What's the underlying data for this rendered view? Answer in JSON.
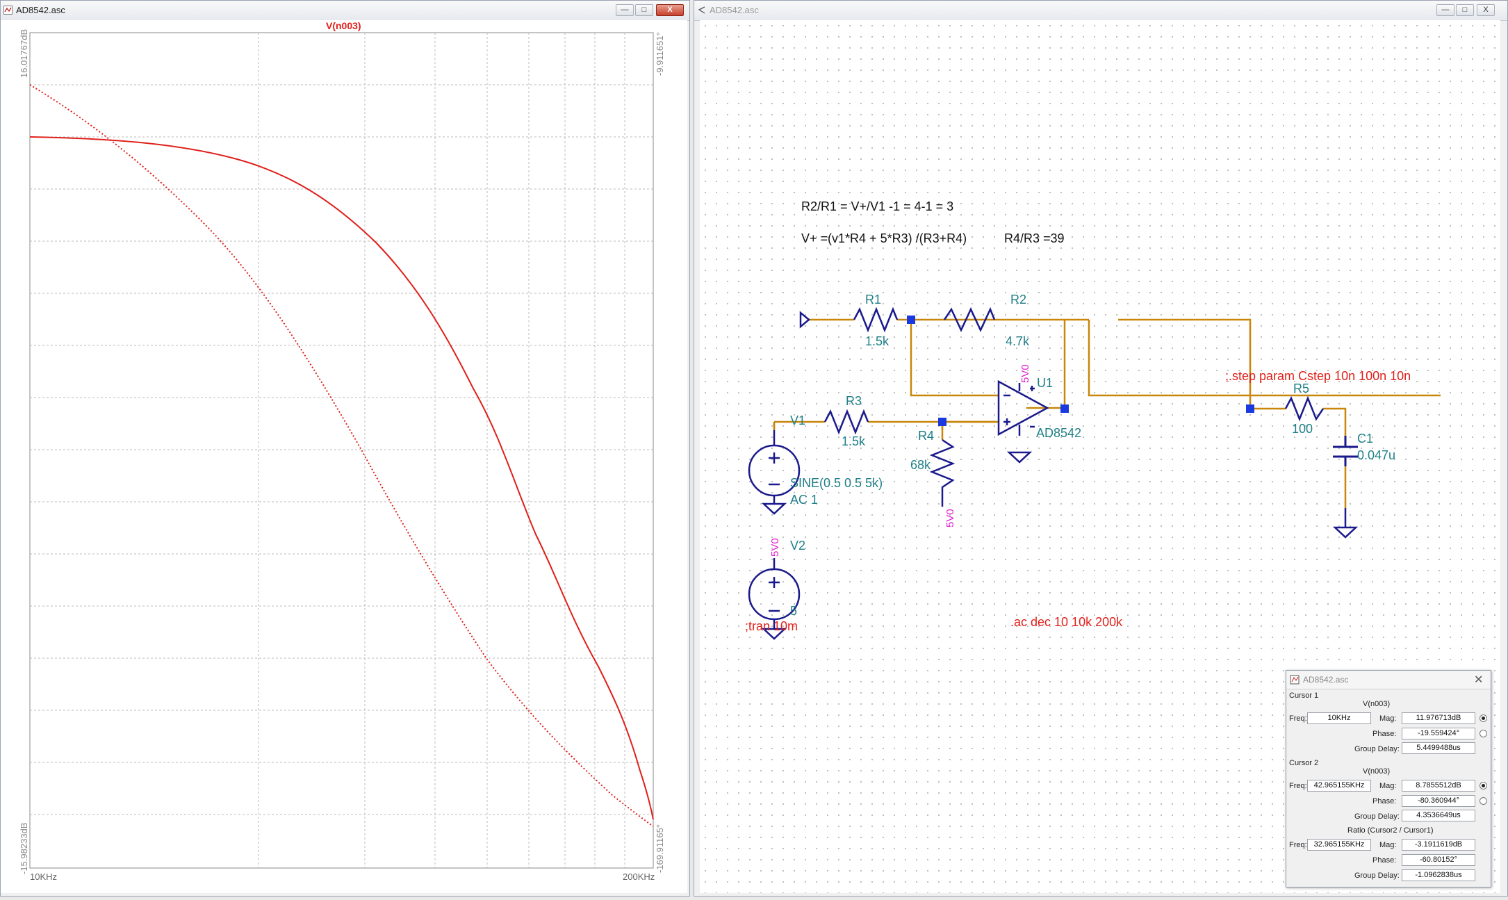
{
  "left_window": {
    "title": "AD8542.asc",
    "trace_label": "V(n003)",
    "y_top_left": "16.01767dB",
    "y_bottom_left": "-15.98233dB",
    "y_top_right": "-9.911651°",
    "y_bottom_right": "-169.91165°",
    "x_left": "10KHz",
    "x_right": "200KHz",
    "controls": [
      "—",
      "□",
      "X"
    ]
  },
  "right_window": {
    "title": "AD8542.asc",
    "controls": [
      "—",
      "□",
      "X"
    ],
    "notes": {
      "eq1": "R2/R1 = V+/V1 -1 = 4-1 = 3",
      "eq2": "V+ =(v1*R4 + 5*R3) /(R3+R4)",
      "eq3": "R4/R3 =39",
      "step": ";.step param Cstep 10n 100n 10n",
      "tran": ";tran 10m",
      "ac": ".ac dec 10 10k 200k"
    },
    "components": {
      "r1_name": "R1",
      "r1_val": "1.5k",
      "r2_name": "R2",
      "r2_val": "4.7k",
      "r3_name": "R3",
      "r3_val": "1.5k",
      "r4_name": "R4",
      "r4_val": "68k",
      "r5_name": "R5",
      "r5_val": "100",
      "c1_name": "C1",
      "c1_val": "0.047u",
      "u1_name": "U1",
      "u1_val": "AD8542",
      "v1_name": "V1",
      "v1_val1": "SINE(0.5 0.5 5k)",
      "v1_val2": "AC 1",
      "v2_name": "V2",
      "v2_val": "5",
      "net_5v0": "5V0"
    }
  },
  "cursor_dialog": {
    "title": "AD8542.asc",
    "cursor1_label": "Cursor 1",
    "cursor1_trace": "V(n003)",
    "cursor1_freq": "10KHz",
    "cursor1_mag": "11.976713dB",
    "cursor1_phase": "-19.559424°",
    "cursor1_gd": "5.4499488us",
    "cursor2_label": "Cursor 2",
    "cursor2_trace": "V(n003)",
    "cursor2_freq": "42.965155KHz",
    "cursor2_mag": "8.7855512dB",
    "cursor2_phase": "-80.360944°",
    "cursor2_gd": "4.3536649us",
    "ratio_label": "Ratio (Cursor2 / Cursor1)",
    "ratio_freq": "32.965155KHz",
    "ratio_mag": "-3.1911619dB",
    "ratio_phase": "-60.80152°",
    "ratio_gd": "-1.0962838us",
    "lbl_freq": "Freq:",
    "lbl_mag": "Mag:",
    "lbl_phase": "Phase:",
    "lbl_gd": "Group Delay:"
  },
  "colors": {
    "trace": "#e0201a",
    "wire": "#c8860a",
    "component": "#1a1a8c",
    "label": "#1e7f86",
    "net": "#e020d0"
  }
}
